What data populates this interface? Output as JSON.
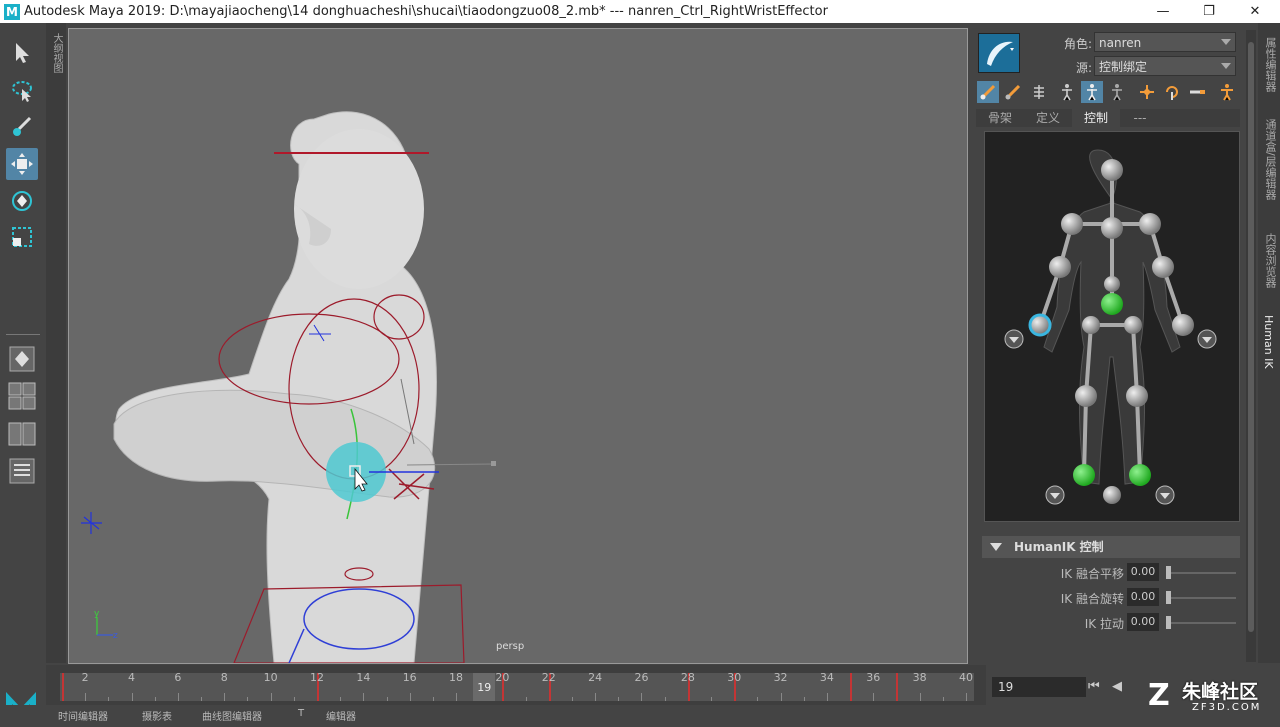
{
  "window": {
    "title": "Autodesk Maya 2019: D:\\mayajiaocheng\\14 donghuacheshi\\shucai\\tiaodongzuo08_2.mb*    ---    nanren_Ctrl_RightWristEffector",
    "app_logo": "M",
    "controls": [
      "minimize-icon",
      "restore-icon",
      "close-icon"
    ],
    "min_glyph": "—",
    "max_glyph": "❐",
    "close_glyph": "✕"
  },
  "left_toolbox": {
    "tools": [
      "select-tool-icon",
      "lasso-tool-icon",
      "paint-select-icon",
      "move-tool-icon",
      "rotate-tool-icon",
      "scale-tool-icon"
    ],
    "active_tool": "move-tool-icon",
    "layouts": [
      "single-pane-icon",
      "four-pane-icon",
      "two-pane-icon",
      "outliner-icon"
    ]
  },
  "left_vertical_tab": "大纲视图",
  "viewport": {
    "camera_label": "persp",
    "axis_y": "y",
    "axis_z": "z"
  },
  "timeline": {
    "tick_labels": [
      "2",
      "4",
      "6",
      "8",
      "10",
      "12",
      "14",
      "16",
      "18",
      "20",
      "22",
      "24",
      "26",
      "28",
      "30",
      "32",
      "34",
      "36",
      "38",
      "40"
    ],
    "key_frames": [
      1,
      12,
      20,
      22,
      28,
      30,
      35,
      37
    ],
    "current_frame": "19",
    "range_start": 1,
    "range_end": 40
  },
  "frame_field": "19",
  "playback": {
    "to_start": "⏮",
    "step_back": "◀"
  },
  "bottom_bar": {
    "items": [
      "时间编辑器",
      "摄影表",
      "曲线图编辑器",
      "T",
      "编辑器"
    ]
  },
  "right_panel": {
    "character_label": "角色:",
    "character_value": "nanren",
    "source_label": "源:",
    "source_value": "控制绑定",
    "tools": [
      "fk-brush-icon",
      "ik-brush-icon",
      "skeleton-icon",
      "figure-full-icon",
      "figure-body-icon",
      "figure-select-icon",
      "pin-translate-icon",
      "pin-rotate-icon",
      "release-pin-icon",
      "stance-pose-icon"
    ],
    "active_tool": "figure-body-icon",
    "tabs": [
      "骨架",
      "定义",
      "控制",
      "---"
    ],
    "active_tab": "控制",
    "section_title": "HumanIK 控制",
    "ik_rows": [
      {
        "label": "IK 融合平移",
        "value": "0.00"
      },
      {
        "label": "IK 融合旋转",
        "value": "0.00"
      },
      {
        "label": "IK 拉动",
        "value": "0.00"
      }
    ]
  },
  "right_tabs": [
    "属性编辑器",
    "通道盒/层编辑器",
    "内容浏览器",
    "Human IK"
  ],
  "active_right_tab": "Human IK",
  "watermark": {
    "main": "朱峰社区",
    "sub": "ZF3D.COM",
    "mark": "Z"
  },
  "colors": {
    "accent": "#5285a6",
    "key_red": "#c43535",
    "selected_green": "#2ec12e",
    "effector_cyan": "#4fc9d1"
  }
}
